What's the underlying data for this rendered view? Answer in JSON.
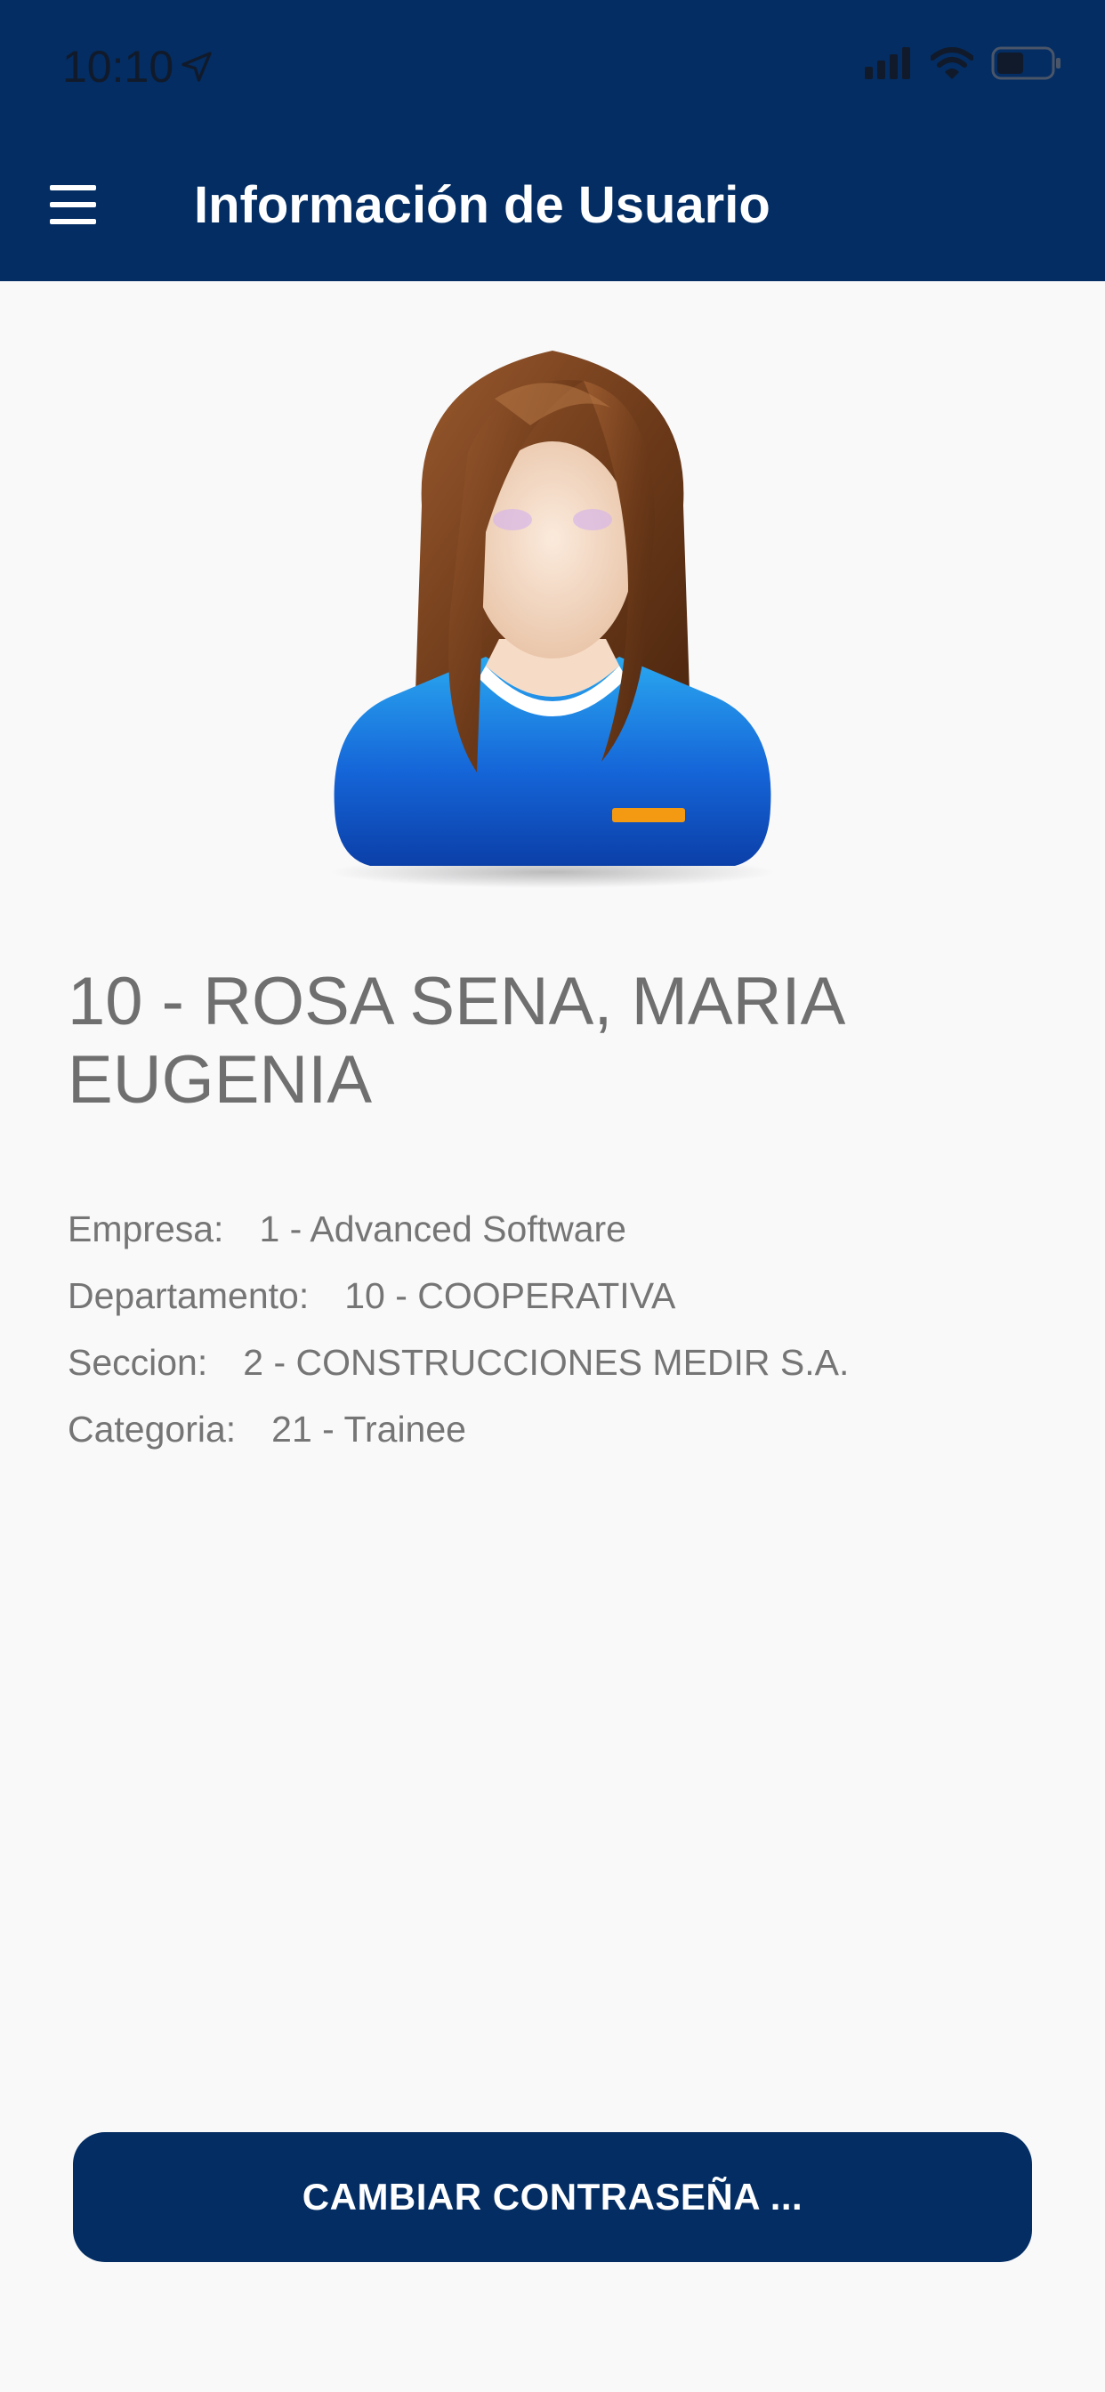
{
  "status_bar": {
    "time": "10:10",
    "location_icon": "location-arrow-icon",
    "signal_icon": "cellular-signal-icon",
    "wifi_icon": "wifi-icon",
    "battery_icon": "battery-icon",
    "battery_level": 0.5
  },
  "header": {
    "menu_icon": "hamburger-menu-icon",
    "title": "Información de Usuario",
    "background_color": "#032d63"
  },
  "profile": {
    "avatar_icon": "female-user-avatar-icon",
    "name": "10 - ROSA SENA, MARIA EUGENIA",
    "details": [
      {
        "label": "Empresa:",
        "value": "1 - Advanced Software"
      },
      {
        "label": "Departamento:",
        "value": "10 - COOPERATIVA"
      },
      {
        "label": "Seccion:",
        "value": "2 - CONSTRUCCIONES MEDIR S.A."
      },
      {
        "label": "Categoria:",
        "value": "21 - Trainee"
      }
    ]
  },
  "actions": {
    "change_password_label": "CAMBIAR CONTRASEÑA ...",
    "button_color": "#032d63"
  }
}
